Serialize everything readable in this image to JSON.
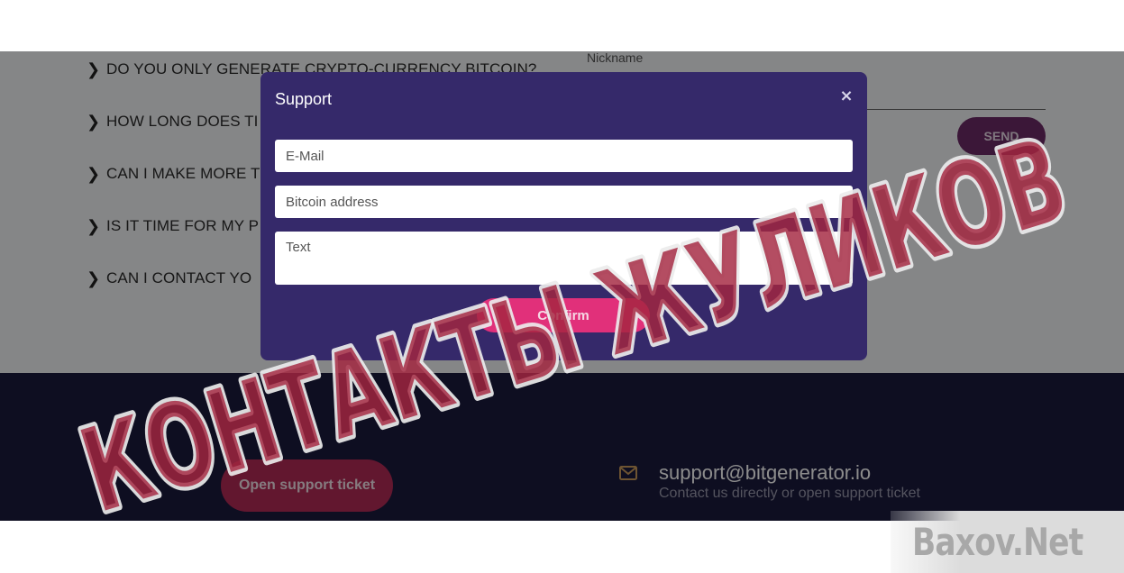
{
  "faq": {
    "items": [
      {
        "label": "DO YOU ONLY GENERATE CRYPTO-CURRENCY BITCOIN?"
      },
      {
        "label": "HOW LONG DOES TI"
      },
      {
        "label": "CAN I MAKE MORE T"
      },
      {
        "label": "IS IT TIME FOR MY P"
      },
      {
        "label": "CAN I CONTACT YO"
      }
    ]
  },
  "contact_form": {
    "nickname_label": "Nickname",
    "send_label": "SEND"
  },
  "footer": {
    "open_ticket_label": "Open support ticket",
    "email": "support@bitgenerator.io",
    "subtitle": "Contact us directly or open support ticket"
  },
  "modal": {
    "title": "Support",
    "close_glyph": "×",
    "email_placeholder": "E-Mail",
    "bitcoin_placeholder": "Bitcoin address",
    "text_placeholder": "Text",
    "confirm_label": "Confirm"
  },
  "overlay_stamp": {
    "text": "КОНТАКТЫ ЖУЛИКОВ"
  },
  "watermark": {
    "text": "Baxov.Net"
  },
  "colors": {
    "modal_bg": "#35296a",
    "footer_bg": "#1b1a3d",
    "confirm": "#e1307a",
    "stamp_red": "#a3263f"
  }
}
